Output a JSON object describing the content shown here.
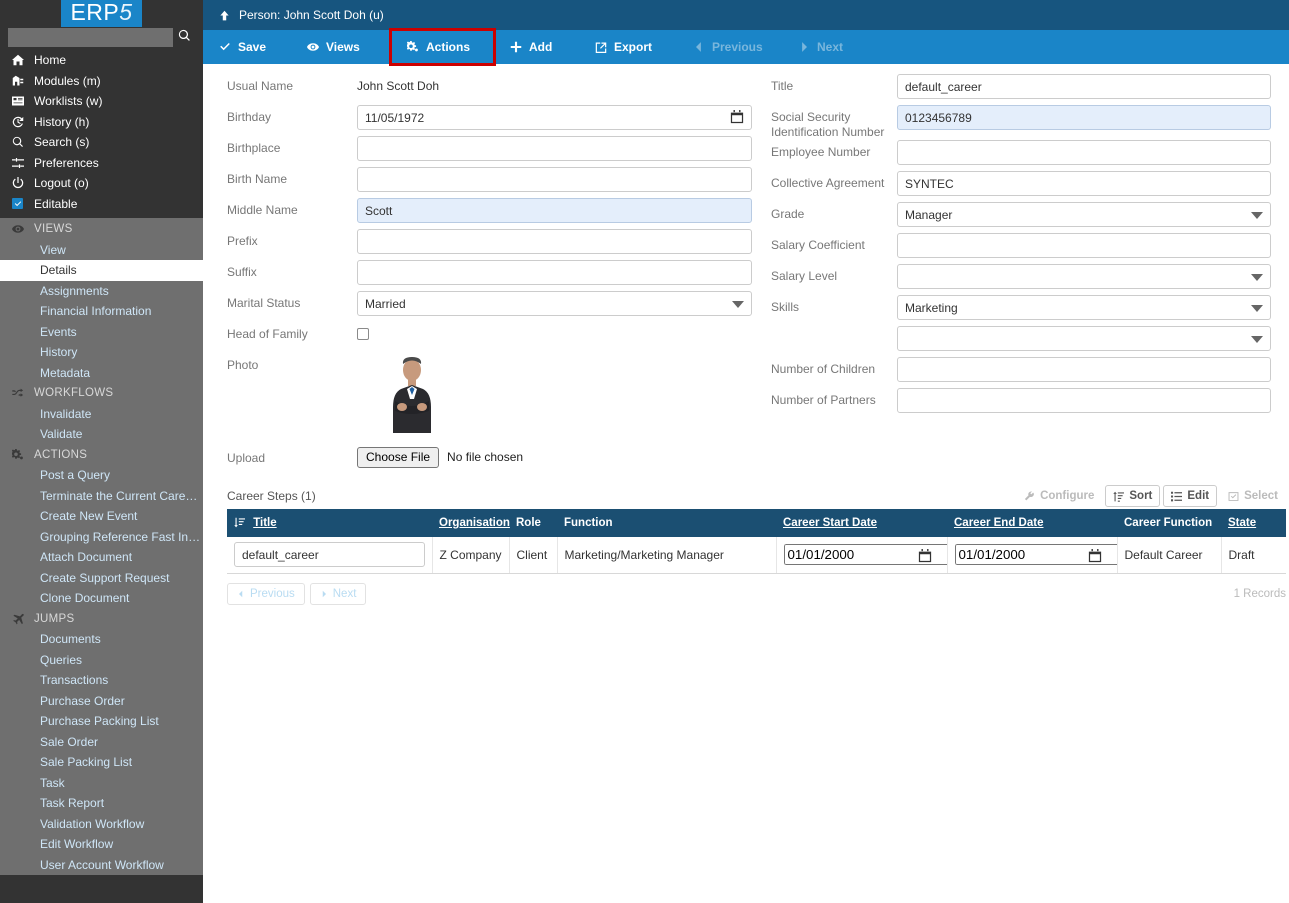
{
  "brand": {
    "logo_main": "ERP",
    "logo_digit": "5"
  },
  "search": {
    "value": "",
    "placeholder": "",
    "icon": "search-icon"
  },
  "sidebar": {
    "main_items": [
      {
        "label": "Home",
        "icon": "home-icon"
      },
      {
        "label": "Modules (m)",
        "icon": "modules-icon"
      },
      {
        "label": "Worklists (w)",
        "icon": "worklists-icon"
      },
      {
        "label": "History (h)",
        "icon": "history-icon"
      },
      {
        "label": "Search (s)",
        "icon": "search-icon"
      },
      {
        "label": "Preferences",
        "icon": "sliders-icon"
      },
      {
        "label": "Logout (o)",
        "icon": "power-icon"
      },
      {
        "label": "Editable",
        "icon": "checkbox-checked-icon"
      }
    ],
    "groups": [
      {
        "title": "VIEWS",
        "icon": "eye-icon",
        "items": [
          {
            "label": "View",
            "active": false
          },
          {
            "label": "Details",
            "active": true
          },
          {
            "label": "Assignments",
            "active": false
          },
          {
            "label": "Financial Information",
            "active": false
          },
          {
            "label": "Events",
            "active": false
          },
          {
            "label": "History",
            "active": false
          },
          {
            "label": "Metadata",
            "active": false
          }
        ]
      },
      {
        "title": "WORKFLOWS",
        "icon": "shuffle-icon",
        "items": [
          {
            "label": "Invalidate",
            "active": false
          },
          {
            "label": "Validate",
            "active": false
          }
        ]
      },
      {
        "title": "ACTIONS",
        "icon": "gears-icon",
        "items": [
          {
            "label": "Post a Query",
            "active": false
          },
          {
            "label": "Terminate the Current Career…",
            "active": false
          },
          {
            "label": "Create New Event",
            "active": false
          },
          {
            "label": "Grouping Reference Fast Input",
            "active": false
          },
          {
            "label": "Attach Document",
            "active": false
          },
          {
            "label": "Create Support Request",
            "active": false
          },
          {
            "label": "Clone Document",
            "active": false
          }
        ]
      },
      {
        "title": "JUMPS",
        "icon": "plane-icon",
        "items": [
          {
            "label": "Documents",
            "active": false
          },
          {
            "label": "Queries",
            "active": false
          },
          {
            "label": "Transactions",
            "active": false
          },
          {
            "label": "Purchase Order",
            "active": false
          },
          {
            "label": "Purchase Packing List",
            "active": false
          },
          {
            "label": "Sale Order",
            "active": false
          },
          {
            "label": "Sale Packing List",
            "active": false
          },
          {
            "label": "Task",
            "active": false
          },
          {
            "label": "Task Report",
            "active": false
          },
          {
            "label": "Validation Workflow",
            "active": false
          },
          {
            "label": "Edit Workflow",
            "active": false
          },
          {
            "label": "User Account Workflow",
            "active": false
          }
        ]
      }
    ]
  },
  "breadcrumb": {
    "text": "Person: John Scott Doh (u)",
    "icon": "arrow-up-icon"
  },
  "toolbar": {
    "save": "Save",
    "views": "Views",
    "actions": "Actions",
    "add": "Add",
    "export": "Export",
    "previous": "Previous",
    "next": "Next",
    "highlight_color": "#cc0000"
  },
  "form": {
    "left": {
      "usual_name_label": "Usual Name",
      "usual_name_value": "John Scott Doh",
      "birthday_label": "Birthday",
      "birthday_value": "11/05/1972",
      "birthplace_label": "Birthplace",
      "birthplace_value": "",
      "birth_name_label": "Birth Name",
      "birth_name_value": "",
      "middle_name_label": "Middle Name",
      "middle_name_value": "Scott",
      "prefix_label": "Prefix",
      "prefix_value": "",
      "suffix_label": "Suffix",
      "suffix_value": "",
      "marital_status_label": "Marital Status",
      "marital_status_value": "Married",
      "head_of_family_label": "Head of Family",
      "head_of_family_checked": false,
      "photo_label": "Photo",
      "upload_label": "Upload",
      "choose_file_label": "Choose File",
      "no_file_label": "No file chosen"
    },
    "right": {
      "title_label": "Title",
      "title_value": "default_career",
      "ssn_label": "Social Security Identification Number",
      "ssn_value": "0123456789",
      "employee_number_label": "Employee Number",
      "employee_number_value": "",
      "collective_agreement_label": "Collective Agreement",
      "collective_agreement_value": "SYNTEC",
      "grade_label": "Grade",
      "grade_value": "Manager",
      "salary_coefficient_label": "Salary Coefficient",
      "salary_coefficient_value": "",
      "salary_level_label": "Salary Level",
      "salary_level_value": "",
      "skills_label": "Skills",
      "skills_value": "Marketing",
      "skills_value_2": "",
      "children_label": "Number of Children",
      "children_value": "",
      "partners_label": "Number of Partners",
      "partners_value": ""
    }
  },
  "listbox": {
    "title": "Career Steps (1)",
    "tools": {
      "configure": "Configure",
      "sort": "Sort",
      "edit": "Edit",
      "select": "Select"
    },
    "columns": [
      "Title",
      "Organisation",
      "Role",
      "Function",
      "Career Start Date",
      "Career End Date",
      "Career Function",
      "State"
    ],
    "rows": [
      {
        "title": "default_career",
        "organisation": "Z Company",
        "role": "Client",
        "function": "Marketing/Marketing Manager",
        "start_date": "01/01/2000",
        "end_date": "01/01/2000",
        "career_function": "Default Career",
        "state": "Draft"
      }
    ],
    "footer": {
      "previous": "Previous",
      "next": "Next",
      "records": "1 Records"
    }
  },
  "colors": {
    "sidebar_dark": "#333333",
    "sidebar_grey": "#6f6f6f",
    "breadcrumb_blue": "#17557f",
    "toolbar_blue": "#1a85c8",
    "table_header_blue": "#1b4f72",
    "modified_field": "#e4eefb",
    "highlight_red": "#cc0000"
  }
}
